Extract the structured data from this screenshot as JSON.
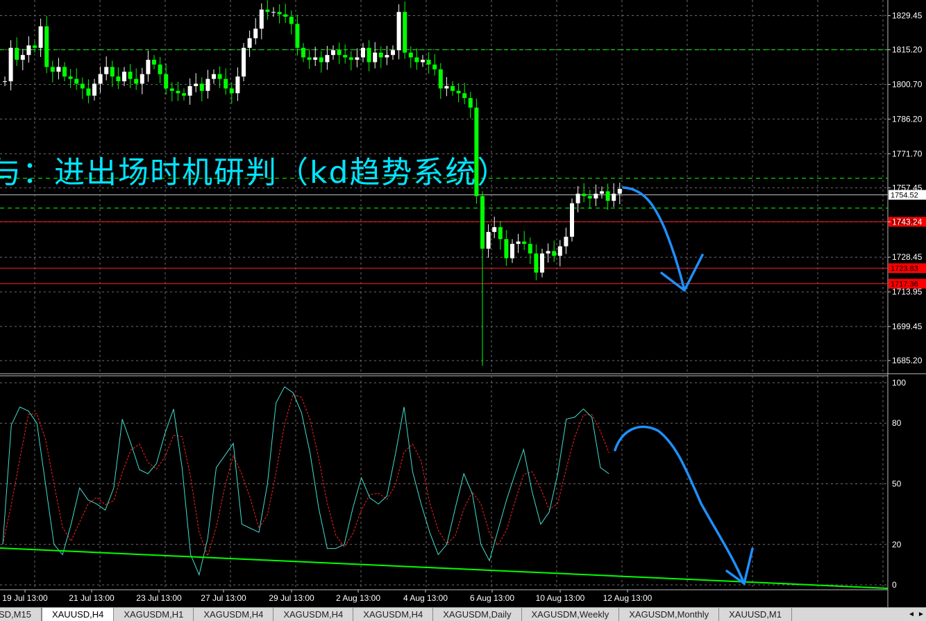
{
  "overlay_title": "与：进出场时机研判（kd趋势系统）",
  "tabs": [
    {
      "label": "SD,M15",
      "active": false
    },
    {
      "label": "XAUUSD,H4",
      "active": true
    },
    {
      "label": "XAGUSDM,H1",
      "active": false
    },
    {
      "label": "XAGUSDM,H4",
      "active": false
    },
    {
      "label": "XAGUSDM,H4",
      "active": false
    },
    {
      "label": "XAGUSDM,H4",
      "active": false
    },
    {
      "label": "XAGUSDM,Daily",
      "active": false
    },
    {
      "label": "XAGUSDM,Weekly",
      "active": false
    },
    {
      "label": "XAGUSDM,Monthly",
      "active": false
    },
    {
      "label": "XAUUSD,M1",
      "active": false
    }
  ],
  "tab_scroll": {
    "left": "◄",
    "right": "►"
  },
  "colors": {
    "background": "#000000",
    "grid": "#6e6e6e",
    "bull": "#ffffff",
    "bear": "#00ff00",
    "k_line": "#40e0d0",
    "d_line": "#ff2020",
    "trendline": "#00ff00",
    "annotation": "#1e90ff",
    "level_line": "#ff1f1f",
    "level_tag_bg": "#ff0000",
    "current_price_line": "#c0c0c0"
  },
  "chart_data": [
    {
      "type": "candlestick",
      "symbol": "XAUUSD",
      "timeframe": "H4",
      "ylim": [
        1680,
        1836
      ],
      "y_ticks": [
        "1829.45",
        "1815.20",
        "1800.70",
        "1786.20",
        "1771.70",
        "1757.45",
        "1743.24",
        "1728.45",
        "1713.95",
        "1699.45",
        "1685.20"
      ],
      "x_ticks": [
        "19 Jul 13:00",
        "21 Jul 13:00",
        "23 Jul 13:00",
        "27 Jul 13:00",
        "29 Jul 13:00",
        "2 Aug 13:00",
        "4 Aug 13:00",
        "6 Aug 13:00",
        "10 Aug 13:00",
        "12 Aug 13:00"
      ],
      "current_price": 1754.52,
      "levels": [
        {
          "value": 1743.24,
          "label": "1743.24"
        },
        {
          "value": 1723.83,
          "label": "1723.83"
        },
        {
          "value": 1717.36,
          "label": "1717.36"
        }
      ],
      "guide_levels": [
        1815.2,
        1761.5,
        1749.0
      ],
      "closes": [
        1802,
        1816,
        1811,
        1813,
        1817,
        1816,
        1825,
        1808,
        1806,
        1808,
        1804,
        1803,
        1801,
        1799,
        1796,
        1801,
        1805,
        1808,
        1804,
        1802,
        1806,
        1803,
        1801,
        1805,
        1811,
        1809,
        1805,
        1799,
        1798,
        1797,
        1796,
        1800,
        1801,
        1798,
        1803,
        1805,
        1803,
        1799,
        1797,
        1804,
        1816,
        1820,
        1824,
        1832,
        1831,
        1831,
        1830,
        1829,
        1826,
        1816,
        1812,
        1811,
        1812,
        1810,
        1813,
        1815,
        1813,
        1812,
        1811,
        1812,
        1816,
        1810,
        1814,
        1812,
        1813,
        1815,
        1831,
        1814,
        1812,
        1810,
        1811,
        1809,
        1807,
        1799,
        1800,
        1798,
        1797,
        1795,
        1791,
        1754,
        1732,
        1739,
        1741,
        1736,
        1728,
        1734,
        1735,
        1734,
        1730,
        1722,
        1730,
        1731,
        1729,
        1733,
        1737,
        1751,
        1755,
        1754,
        1753,
        1755,
        1756,
        1752,
        1755,
        1757
      ],
      "k_line": [
        20,
        79,
        88,
        86,
        80,
        50,
        20,
        15,
        30,
        48,
        42,
        40,
        37,
        48,
        82,
        70,
        57,
        55,
        60,
        75,
        87,
        58,
        15,
        5,
        23,
        58,
        64,
        70,
        30,
        28,
        26,
        50,
        90,
        98,
        95,
        85,
        65,
        38,
        18,
        18,
        20,
        38,
        53,
        43,
        40,
        44,
        65,
        88,
        56,
        40,
        26,
        15,
        20,
        38,
        55,
        45,
        20,
        12,
        27,
        42,
        55,
        67,
        46,
        30,
        36,
        55,
        82,
        83,
        87,
        83,
        58,
        55
      ]
    }
  ],
  "oscillator": {
    "name": "KD",
    "ylim": [
      0,
      100
    ],
    "y_ticks": [
      "100",
      "80",
      "50",
      "20",
      "0"
    ]
  }
}
